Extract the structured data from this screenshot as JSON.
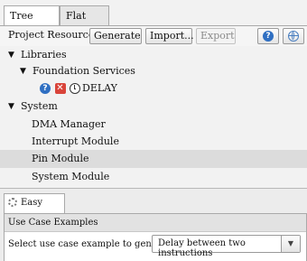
{
  "tabs": {
    "tree_view": "Tree View",
    "flat_view": "Flat View"
  },
  "toolbar": {
    "label": "Project Resources",
    "generate": "Generate",
    "import": "Import...",
    "export": "Export"
  },
  "tree": {
    "libraries": "Libraries",
    "foundation_services": "Foundation Services",
    "delay": "DELAY",
    "system": "System",
    "dma_manager": "DMA Manager",
    "interrupt_module": "Interrupt Module",
    "pin_module": "Pin Module",
    "system_module": "System Module",
    "selected": "Pin Module"
  },
  "icons": {
    "help": "help-icon",
    "globe": "globe-icon",
    "delay_status": [
      "help-icon",
      "error-icon",
      "clock-icon"
    ]
  },
  "easy_setup": {
    "tab_label": "Easy Setup",
    "section_title": "Use Case Examples",
    "select_label": "Select use case example to generate:",
    "select_value": "Delay between two instructions"
  },
  "colors": {
    "error": "#d9443a",
    "info": "#2f6fc2",
    "selected_row": "#dcdcdc"
  }
}
